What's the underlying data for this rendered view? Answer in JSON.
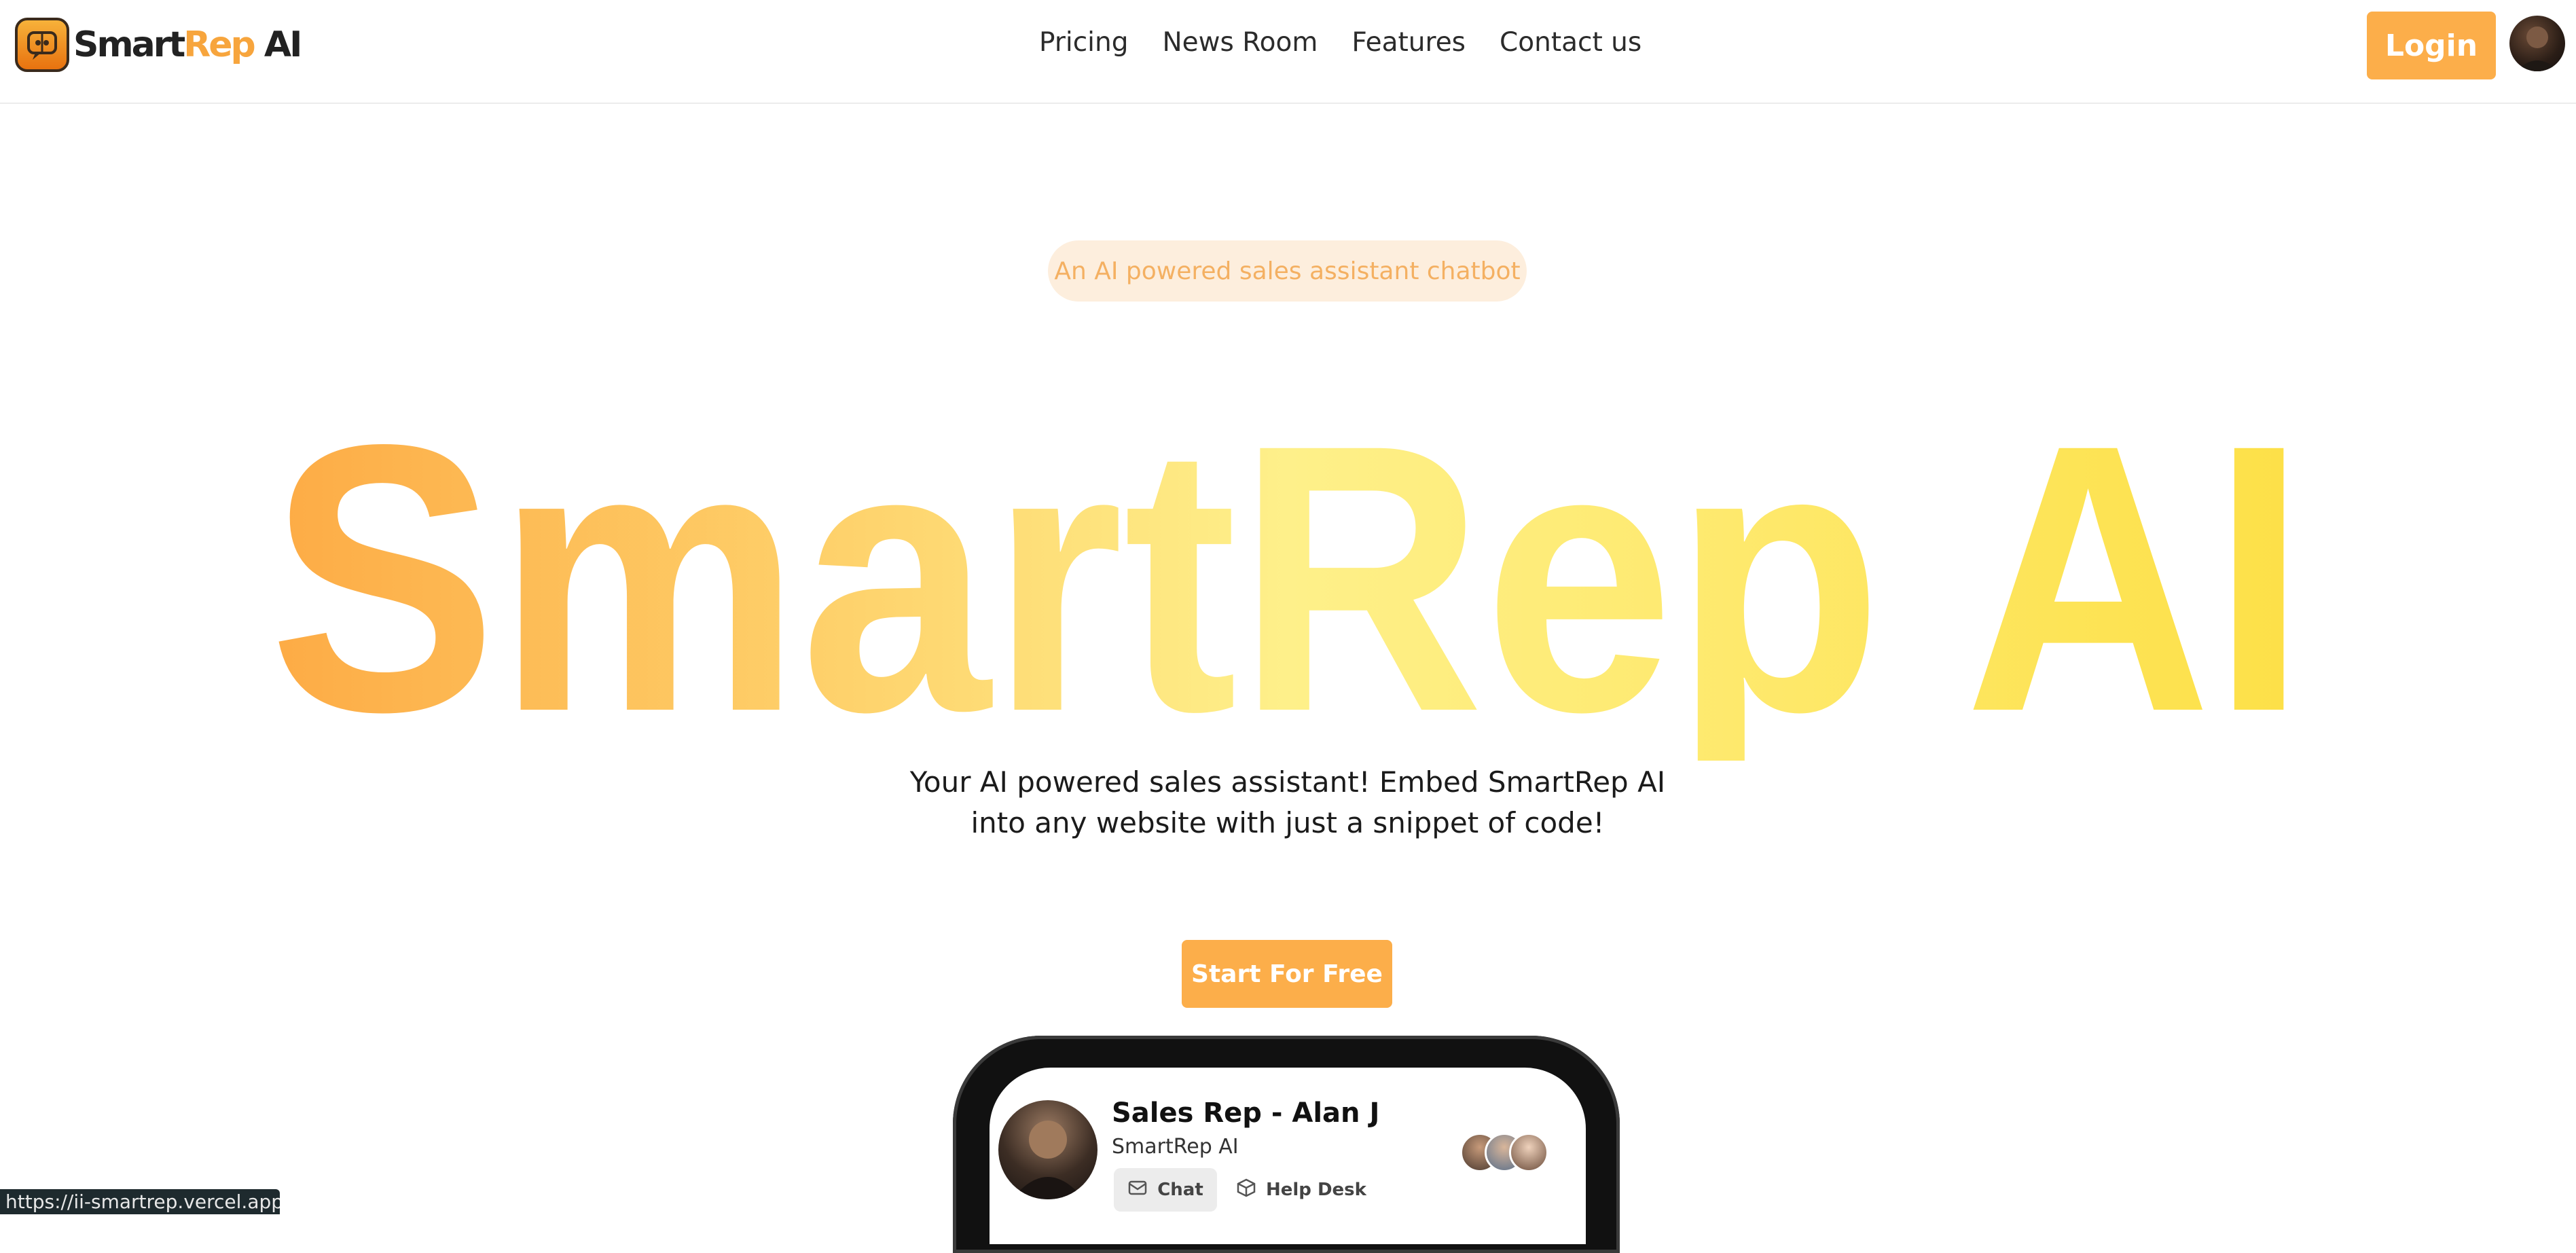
{
  "brand": {
    "name_part1": "Smart",
    "name_part2": "Rep",
    "name_part3": " AI"
  },
  "nav": {
    "items": [
      {
        "label": "Pricing"
      },
      {
        "label": "News Room"
      },
      {
        "label": "Features"
      },
      {
        "label": "Contact us"
      }
    ],
    "login_label": "Login"
  },
  "hero": {
    "badge": "An AI powered sales assistant chatbot",
    "title": "SmartRep AI",
    "subtitle": "Your AI powered sales assistant! Embed SmartRep AI into any website with just a snippet of code!",
    "cta_label": "Start For Free",
    "gradient": [
      "#fdab45",
      "#fef08a",
      "#fde047"
    ]
  },
  "chat_preview": {
    "rep_name": "Sales Rep - Alan J",
    "company": "SmartRep AI",
    "tabs": [
      {
        "label": "Chat",
        "icon": "mail-icon"
      },
      {
        "label": "Help Desk",
        "icon": "box-icon"
      }
    ]
  },
  "status_bar": {
    "url": "https://ii-smartrep.vercel.app"
  },
  "colors": {
    "accent": "#fcae4a",
    "badge_bg": "#fdeedd",
    "badge_text": "#f4b062"
  }
}
